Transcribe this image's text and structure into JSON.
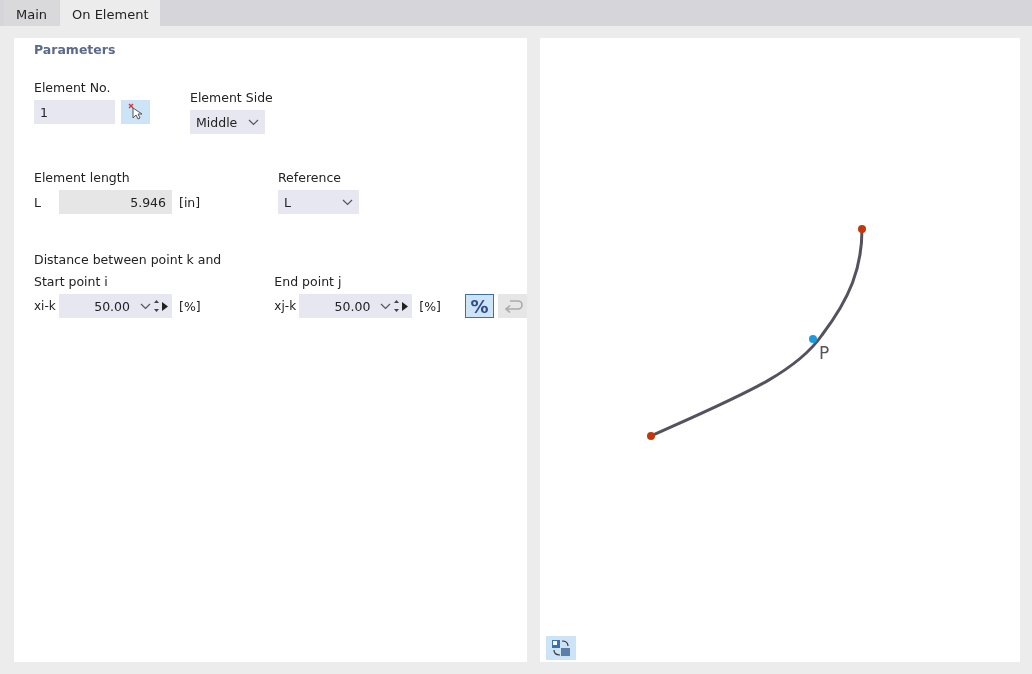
{
  "tabs": [
    {
      "label": "Main",
      "selected": false
    },
    {
      "label": "On Element",
      "selected": true
    }
  ],
  "parameters": {
    "title": "Parameters",
    "element_no": {
      "label": "Element No.",
      "value": "1"
    },
    "element_side": {
      "label": "Element Side",
      "value": "Middle"
    },
    "element_length": {
      "label": "Element length",
      "symbol": "L",
      "value": "5.946",
      "unit": "[in]"
    },
    "reference": {
      "label": "Reference",
      "value": "L"
    },
    "distance_heading": "Distance between point k and",
    "start": {
      "label": "Start point i",
      "symbol": "xi-k",
      "value": "50.00",
      "unit": "[%]"
    },
    "end": {
      "label": "End point j",
      "symbol": "xj-k",
      "value": "50.00",
      "unit": "[%]"
    },
    "percent_button": {
      "label": "%",
      "selected": true
    },
    "reset_button": {
      "disabled": true
    }
  },
  "preview": {
    "point_label": "P"
  }
}
